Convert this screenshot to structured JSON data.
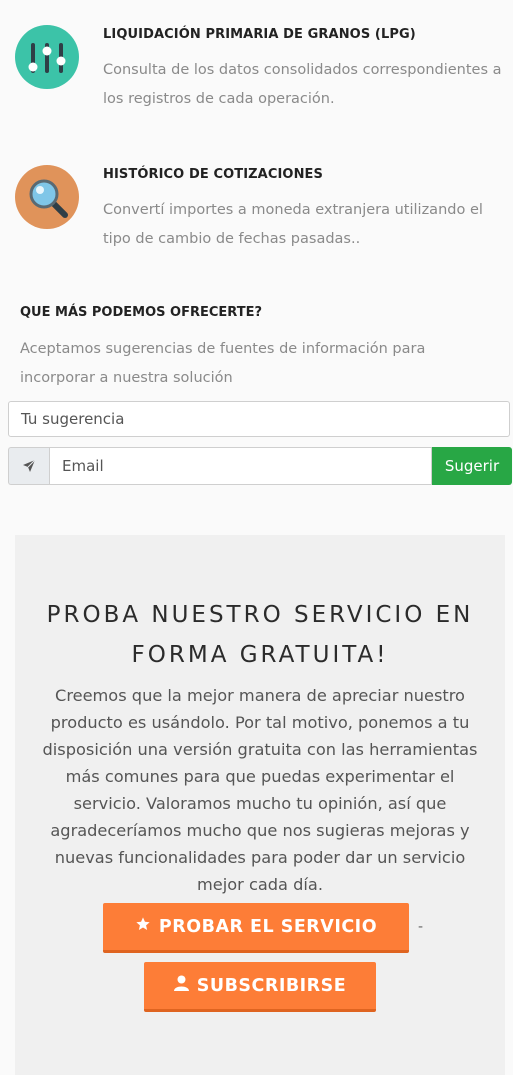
{
  "features": [
    {
      "icon": "sliders-icon",
      "title": "LIQUIDACIÓN PRIMARIA DE GRANOS (LPG)",
      "description": "Consulta de los datos consolidados correspondientes a los registros de cada operación.",
      "icon_color": "#3cc3a8"
    },
    {
      "icon": "magnifier-icon",
      "title": "HISTÓRICO DE COTIZACIONES",
      "description": "Convertí importes a moneda extranjera utilizando el tipo de cambio de fechas pasadas..",
      "icon_color": "#e0935a"
    }
  ],
  "offer": {
    "title": "QUE MÁS PODEMOS OFRECERTE?",
    "description": "Aceptamos sugerencias de fuentes de información para incorporar a nuestra solución",
    "suggestion_placeholder": "Tu sugerencia",
    "email_placeholder": "Email",
    "email_icon": "paper-plane-icon",
    "submit_label": "Sugerir"
  },
  "promo": {
    "title": "PROBA NUESTRO SERVICIO EN FORMA GRATUITA!",
    "text": "Creemos que la mejor manera de apreciar nuestro producto es usándolo. Por tal motivo, ponemos a tu disposición una versión gratuita con las herramientas más comunes para que puedas experimentar el servicio. Valoramos mucho tu opinión, así que agradeceríamos mucho que nos sugieras mejoras y nuevas funcionalidades para poder dar un servicio mejor cada día.",
    "try_label": "PROBAR EL SERVICIO",
    "try_icon": "star-icon",
    "separator": "-",
    "subscribe_label": "SUBSCRIBIRSE",
    "subscribe_icon": "user-icon"
  },
  "colors": {
    "teal": "#3cc3a8",
    "orange": "#fd7d37",
    "green": "#28a745",
    "tan": "#e0935a"
  }
}
